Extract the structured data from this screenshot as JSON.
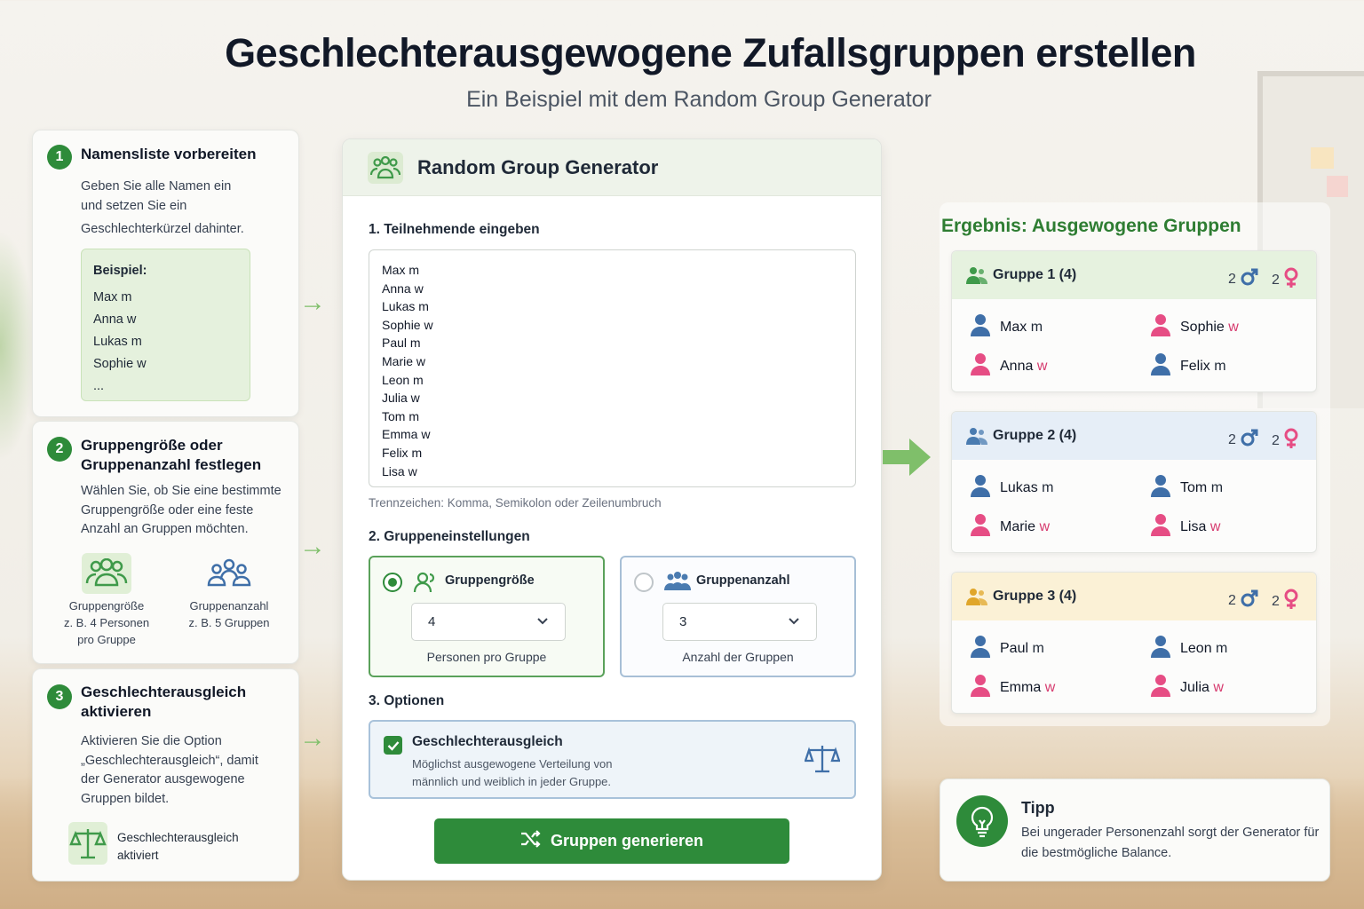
{
  "page": {
    "title": "Geschlechterausgewogene Zufallsgruppen erstellen",
    "subtitle": "Ein Beispiel mit dem Random Group Generator"
  },
  "steps": [
    {
      "number": "1",
      "title": "Namensliste vorbereiten",
      "text_lines": [
        "Geben Sie alle Namen ein",
        "und setzen Sie ein",
        "Geschlechterkürzel dahinter."
      ],
      "example_label": "Beispiel:",
      "example_items": [
        "Max m",
        "Anna w",
        "Lukas m",
        "Sophie w",
        "..."
      ]
    },
    {
      "number": "2",
      "title_lines": [
        "Gruppengröße oder",
        "Gruppenanzahl festlegen"
      ],
      "text_lines": [
        "Wählen Sie, ob Sie eine bestimmte",
        "Gruppengröße oder eine feste",
        "Anzahl an Gruppen möchten."
      ],
      "option_a": {
        "lines": [
          "Gruppengröße",
          "z. B. 4 Personen",
          "pro Gruppe"
        ]
      },
      "option_b": {
        "lines": [
          "Gruppenanzahl",
          "z. B. 5 Gruppen"
        ]
      }
    },
    {
      "number": "3",
      "title_lines": [
        "Geschlechterausgleich",
        "aktivieren"
      ],
      "text_lines": [
        "Aktivieren Sie die Option",
        "„Geschlechterausgleich“, damit",
        "der Generator ausgewogene",
        "Gruppen bildet."
      ],
      "status_lines": [
        "Geschlechterausgleich",
        "aktiviert"
      ]
    }
  ],
  "app": {
    "title": "Random Group Generator",
    "section1_label": "1. Teilnehmende eingeben",
    "participants": [
      "Max m",
      "Anna w",
      "Lukas m",
      "Sophie w",
      "Paul m",
      "Marie w",
      "Leon m",
      "Julia w",
      "Tom m",
      "Emma w",
      "Felix m",
      "Lisa w"
    ],
    "separator_hint": "Trennzeichen: Komma, Semikolon oder Zeilenumbruch",
    "section2_label": "2. Gruppeneinstellungen",
    "group_size": {
      "label": "Gruppengröße",
      "value": "4",
      "caption": "Personen pro Gruppe",
      "selected": true
    },
    "group_count": {
      "label": "Gruppenanzahl",
      "value": "3",
      "caption": "Anzahl der Gruppen",
      "selected": false
    },
    "section3_label": "3. Optionen",
    "gender_balance": {
      "label": "Geschlechterausgleich",
      "desc_lines": [
        "Möglichst ausgewogene Verteilung von",
        "männlich und weiblich in jeder Gruppe."
      ],
      "checked": true
    },
    "generate_button": "Gruppen generieren"
  },
  "results": {
    "title": "Ergebnis: Ausgewogene Gruppen",
    "groups": [
      {
        "name": "Gruppe 1 (4)",
        "male_count": "2",
        "female_count": "2",
        "color": "#e6f2df",
        "icon_color": "#3f9a4a",
        "members": [
          {
            "name": "Max",
            "gender": "m"
          },
          {
            "name": "Sophie",
            "gender": "w"
          },
          {
            "name": "Anna",
            "gender": "w"
          },
          {
            "name": "Felix",
            "gender": "m"
          }
        ]
      },
      {
        "name": "Gruppe 2 (4)",
        "male_count": "2",
        "female_count": "2",
        "color": "#e6eef7",
        "icon_color": "#4a7bb0",
        "members": [
          {
            "name": "Lukas",
            "gender": "m"
          },
          {
            "name": "Tom",
            "gender": "m"
          },
          {
            "name": "Marie",
            "gender": "w"
          },
          {
            "name": "Lisa",
            "gender": "w"
          }
        ]
      },
      {
        "name": "Gruppe 3 (4)",
        "male_count": "2",
        "female_count": "2",
        "color": "#fbf1d6",
        "icon_color": "#e0a62a",
        "members": [
          {
            "name": "Paul",
            "gender": "m"
          },
          {
            "name": "Leon",
            "gender": "m"
          },
          {
            "name": "Emma",
            "gender": "w"
          },
          {
            "name": "Julia",
            "gender": "w"
          }
        ]
      }
    ]
  },
  "tip": {
    "title": "Tipp",
    "text": "Bei ungerader Personenzahl sorgt der Generator für die bestmögliche Balance."
  },
  "colors": {
    "accent": "#2e8b3a",
    "male": "#3f6fa8",
    "female": "#e64d84"
  }
}
